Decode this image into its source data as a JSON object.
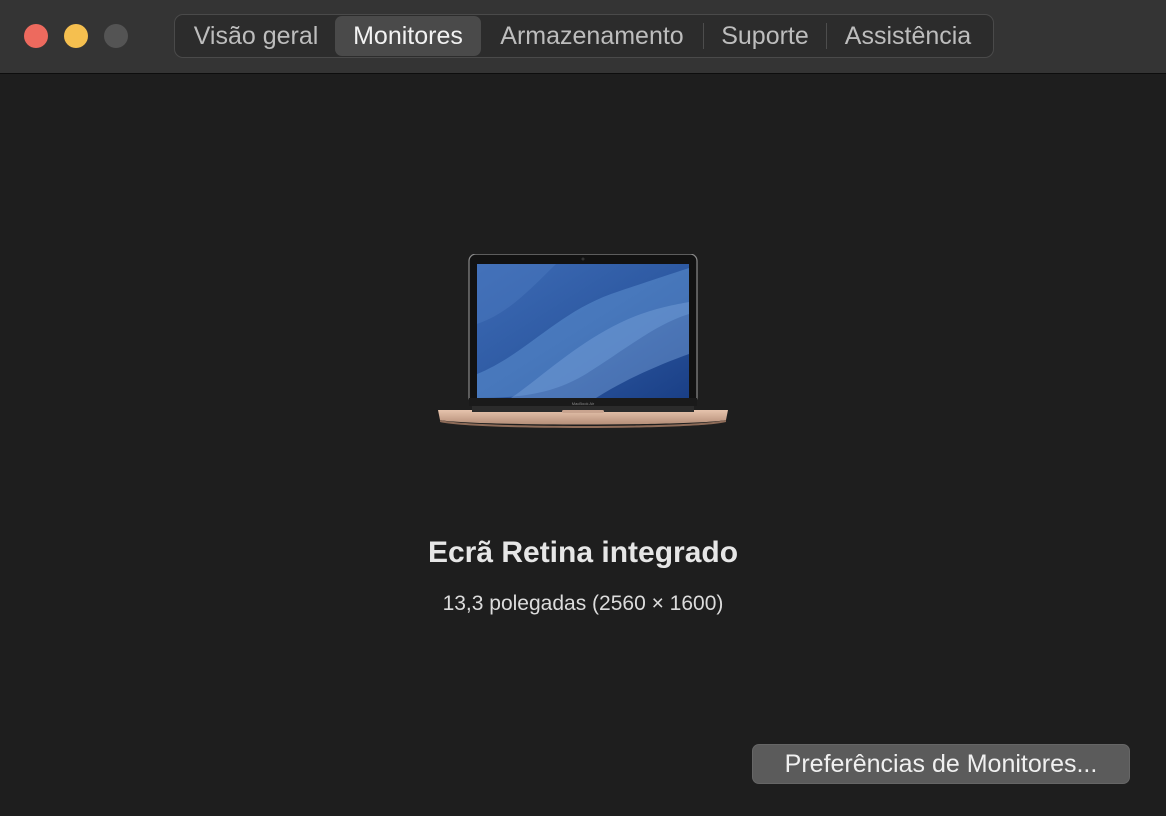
{
  "tabs": [
    {
      "label": "Visão geral",
      "active": false
    },
    {
      "label": "Monitores",
      "active": true
    },
    {
      "label": "Armazenamento",
      "active": false
    },
    {
      "label": "Suporte",
      "active": false
    },
    {
      "label": "Assistência",
      "active": false
    }
  ],
  "display": {
    "name": "Ecrã Retina integrado",
    "details": "13,3 polegadas (2560 × 1600)",
    "image_icon": "macbook-air-gold-icon"
  },
  "preferences_button": {
    "label": "Preferências de Monitores..."
  },
  "colors": {
    "window_bg": "#1e1e1e",
    "titlebar_bg": "#343434",
    "close": "#ed6a5e",
    "minimize": "#f5bf4f",
    "zoom_inactive": "#545454"
  }
}
